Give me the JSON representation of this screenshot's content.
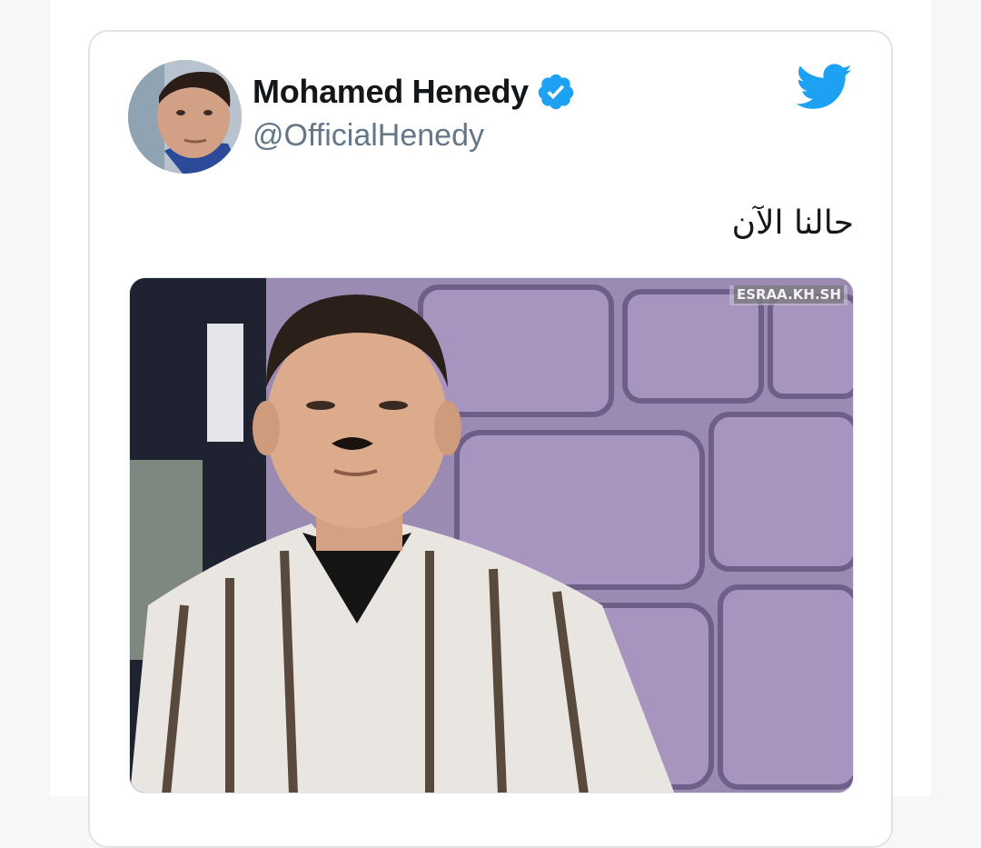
{
  "tweet": {
    "author_name": "Mohamed Henedy",
    "handle": "@OfficialHenedy",
    "text": "حالنا الآن",
    "verified": true,
    "media_watermark": "ESRAA.KH.SH"
  },
  "icons": {
    "verified": "verified-badge-icon",
    "brand": "twitter-bird-icon"
  },
  "colors": {
    "brand_blue": "#1da1f2",
    "name_text": "#14171a",
    "handle_text": "#657786"
  }
}
